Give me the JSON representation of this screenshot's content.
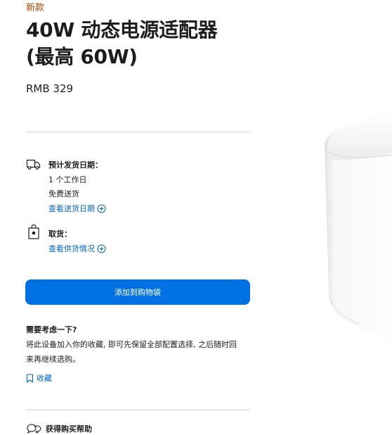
{
  "badge": "新款",
  "product": {
    "title_line1": "40W 动态电源适配器",
    "title_line2": "(最高 60W)",
    "price": "RMB 329"
  },
  "delivery": {
    "icon": "truck-icon",
    "heading": "预计发货日期：",
    "line1": "1 个工作日",
    "line2": "免费送货",
    "link": "查看送货日期"
  },
  "pickup": {
    "icon": "shopping-bag-icon",
    "heading": "取货：",
    "link": "查看供货情况"
  },
  "add_to_bag": "添加到购物袋",
  "consider": {
    "title": "需要考虑一下?",
    "text": "将此设备加入你的收藏, 即可先保留全部配置选择, 之后随时回来再继续选购。",
    "save_link": "收藏"
  },
  "help": {
    "label": "获得购买帮助"
  },
  "colors": {
    "accent": "#0071e3",
    "link": "#0066cc",
    "badge": "#b64400"
  }
}
